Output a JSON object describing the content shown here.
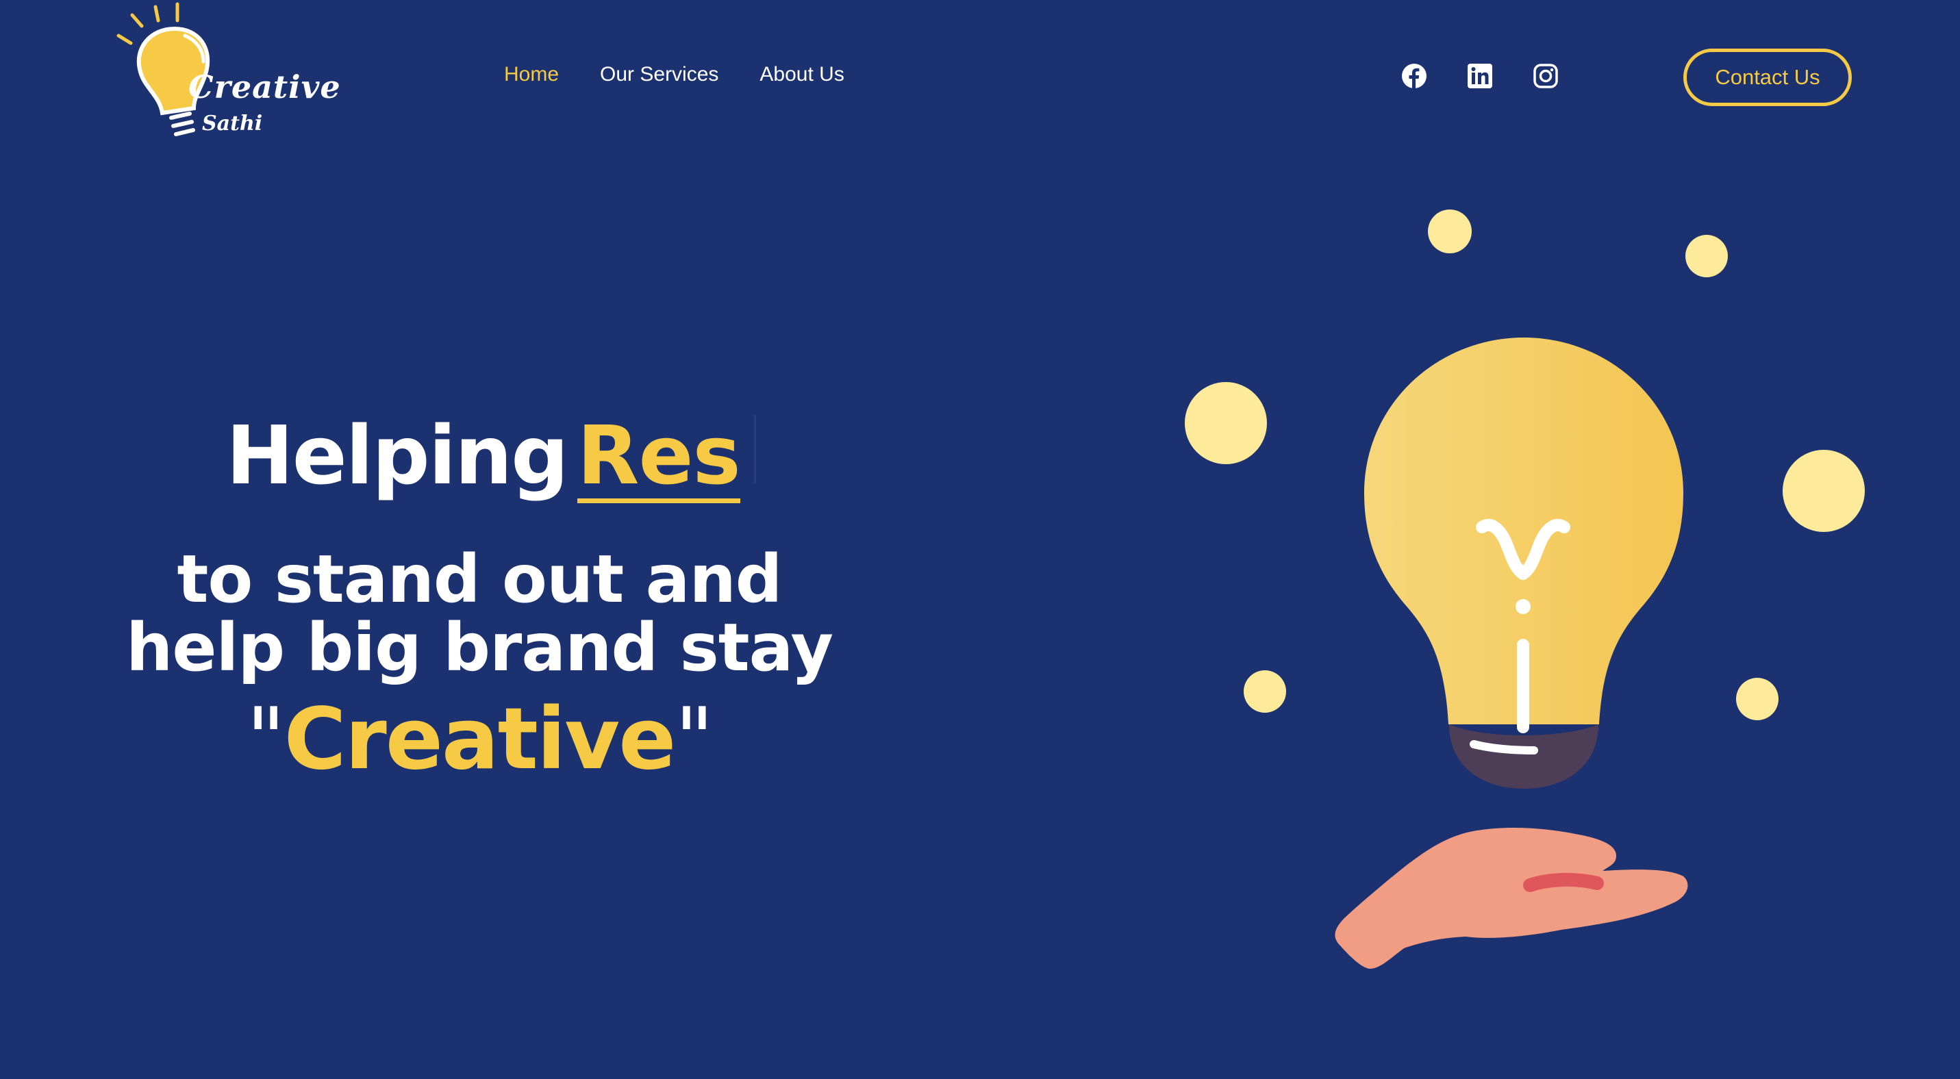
{
  "logo": {
    "word1": "Creative",
    "word2": "Sathi"
  },
  "nav": {
    "items": [
      {
        "label": "Home",
        "active": true
      },
      {
        "label": "Our Services",
        "active": false
      },
      {
        "label": "About Us",
        "active": false
      }
    ]
  },
  "social": {
    "icons": [
      "facebook-icon",
      "linkedin-icon",
      "instagram-icon"
    ]
  },
  "header": {
    "contact_label": "Contact Us"
  },
  "hero": {
    "line1_white": "Helping",
    "line1_typed": "Res",
    "line2": "to stand out and",
    "line3": "help big brand stay",
    "quote_open": "\"",
    "highlight": "Creative",
    "quote_close": "\""
  },
  "colors": {
    "background": "#1b3170",
    "accent": "#f6ca45",
    "bulb_light": "#f6d77a",
    "dots": "#fdeb9b",
    "hand": "#f19d84",
    "bulb_base": "#4d3d57"
  }
}
